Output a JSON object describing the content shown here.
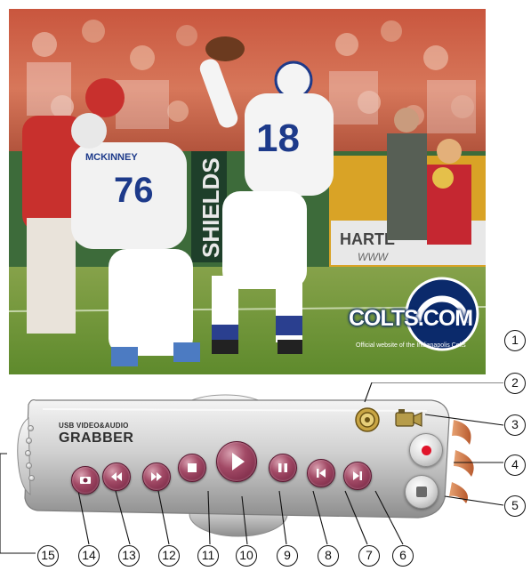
{
  "video": {
    "jersey_number": "18",
    "jersey_number_lineman": "76",
    "lineman_name": "MCKINNEY",
    "banner_left": "SHIELDS",
    "banner_right": "HARTE",
    "banner_right_sub": "WWW",
    "logo_title": "COLTS.COM",
    "logo_caption": "Official website of the Indianapolis Colts"
  },
  "panel": {
    "brand_small": "USB VIDEO&AUDIO",
    "brand_big": "GRABBER",
    "buttons": [
      {
        "id": "snapshot",
        "icon": "snapshot-icon"
      },
      {
        "id": "rewind",
        "icon": "rewind-icon"
      },
      {
        "id": "fast-forward",
        "icon": "fast-forward-icon"
      },
      {
        "id": "stop",
        "icon": "stop-icon"
      },
      {
        "id": "play",
        "icon": "play-icon"
      },
      {
        "id": "pause",
        "icon": "pause-icon"
      },
      {
        "id": "previous",
        "icon": "skip-back-icon"
      },
      {
        "id": "next",
        "icon": "skip-forward-icon"
      },
      {
        "id": "settings",
        "icon": "gear-icon"
      },
      {
        "id": "camera-source",
        "icon": "camera-icon"
      },
      {
        "id": "record",
        "icon": "record-icon"
      },
      {
        "id": "stop-record",
        "icon": "stop-record-icon"
      }
    ]
  },
  "callouts": [
    "1",
    "2",
    "3",
    "4",
    "5",
    "6",
    "7",
    "8",
    "9",
    "10",
    "11",
    "12",
    "13",
    "14",
    "15"
  ],
  "colors": {
    "button_maroon": "#8a2d4f",
    "record_red": "#e0142a",
    "colts_blue": "#0b2a6b"
  }
}
